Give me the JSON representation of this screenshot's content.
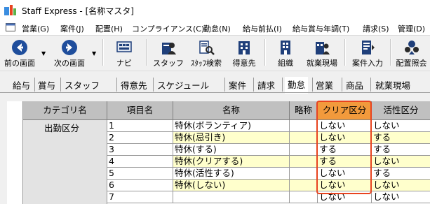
{
  "window": {
    "title": "Staff Express - [名称マスタ]"
  },
  "menu": {
    "items": [
      "営業(G)",
      "案件(J)",
      "配置(H)",
      "コンプライアンス(C)",
      "勤怠(N)",
      "給与前払(I)",
      "給与賞与年調(T)",
      "請求(S)",
      "管理(D)"
    ]
  },
  "toolbar": {
    "buttons": [
      {
        "label": "前の画面",
        "icon": "back-arrow-icon"
      },
      {
        "label": "次の画面",
        "icon": "forward-arrow-icon"
      },
      {
        "label": "ナビ",
        "icon": "navi-icon"
      },
      {
        "label": "スタッフ",
        "icon": "staff-icon"
      },
      {
        "label": "ｽﾀｯﾌ検索",
        "icon": "staff-search-icon"
      },
      {
        "label": "得意先",
        "icon": "client-icon"
      },
      {
        "label": "組織",
        "icon": "organization-icon"
      },
      {
        "label": "就業現場",
        "icon": "worksite-icon"
      },
      {
        "label": "案件入力",
        "icon": "project-input-icon"
      },
      {
        "label": "配置照会",
        "icon": "placement-inquiry-icon"
      }
    ]
  },
  "tabs": {
    "items": [
      "給与",
      "賞与",
      "スタッフ",
      "得意先",
      "スケジュール",
      "案件",
      "請求",
      "勤怠",
      "営業",
      "商品",
      "就業現場"
    ],
    "active": "勤怠"
  },
  "grid": {
    "headers": [
      "カテゴリ名",
      "項目名",
      "名称",
      "略称",
      "クリア区分",
      "活性区分"
    ],
    "category": "出勤区分",
    "rows": [
      {
        "item": "1",
        "name": "特休(ボランティア)",
        "abbr": "",
        "clear": "しない",
        "active": "しない"
      },
      {
        "item": "2",
        "name": "特休(忌引き)",
        "abbr": "",
        "clear": "しない",
        "active": "する"
      },
      {
        "item": "3",
        "name": "特休(する)",
        "abbr": "",
        "clear": "する",
        "active": "する"
      },
      {
        "item": "4",
        "name": "特休(クリアする)",
        "abbr": "",
        "clear": "する",
        "active": "しない"
      },
      {
        "item": "5",
        "name": "特休(活性する)",
        "abbr": "",
        "clear": "しない",
        "active": "する"
      },
      {
        "item": "6",
        "name": "特休(しない)",
        "abbr": "",
        "clear": "しない",
        "active": "しない"
      },
      {
        "item": "7",
        "name": "",
        "abbr": "",
        "clear": "しない",
        "active": "しない"
      }
    ]
  },
  "colors": {
    "highlight_header": "#f29a3c",
    "highlight_border": "#e8431f",
    "row_even": "#ffffcc",
    "row_odd": "#ffffff",
    "header_bg": "#c0c0c0"
  }
}
